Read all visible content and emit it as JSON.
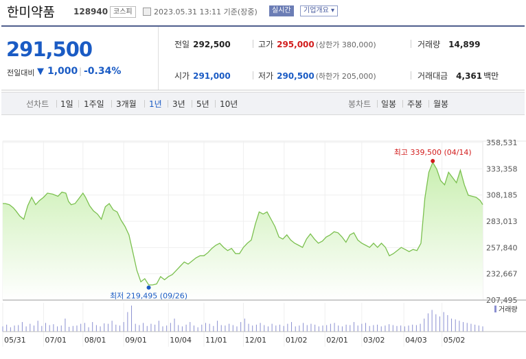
{
  "header": {
    "name": "한미약품",
    "code": "128940",
    "market": "코스피",
    "timestamp": "2023.05.31 13:11 기준(장중)",
    "live_button": "실시간",
    "company_button": "기업개요 ▾"
  },
  "quote": {
    "price": "291,500",
    "change_label": "전일대비",
    "change_arrow": "▼",
    "change_value": "1,000",
    "change_pct": "-0.34%",
    "prev_close_label": "전일",
    "prev_close": "292,500",
    "high_label": "고가",
    "high": "295,000",
    "upper_limit": "(상한가 380,000)",
    "volume_label": "거래량",
    "volume": "14,899",
    "open_label": "시가",
    "open": "291,000",
    "low_label": "저가",
    "low": "290,500",
    "lower_limit": "(하한가 205,000)",
    "turnover_label": "거래대금",
    "turnover": "4,361",
    "turnover_unit": "백만"
  },
  "tabs": {
    "line_label": "선차트",
    "periods": [
      "1일",
      "1주일",
      "3개월",
      "1년",
      "3년",
      "5년",
      "10년"
    ],
    "selected": "1년",
    "candle_label": "봉차트",
    "candle_periods": [
      "일봉",
      "주봉",
      "월봉"
    ]
  },
  "colors": {
    "price_down": "#1a5bc4",
    "price_up": "#d21c1c",
    "line": "#7bc04f",
    "area_top": "#c9efb0",
    "volume": "#8a8fd1"
  },
  "chart_data": {
    "type": "area",
    "y_ticks": [
      "358,531",
      "333,358",
      "308,185",
      "283,013",
      "257,840",
      "232,667",
      "207,495"
    ],
    "ylim": [
      207495,
      358531
    ],
    "x_ticks": [
      "05/31",
      "07/01",
      "08/01",
      "09/01",
      "10/04",
      "11/01",
      "12/01",
      "01/02",
      "02/01",
      "03/02",
      "04/03",
      "05/02"
    ],
    "x": [
      0,
      2,
      5,
      8,
      10,
      13,
      16,
      19,
      22,
      25,
      28,
      31,
      34,
      38,
      42,
      45,
      48,
      50,
      52,
      55,
      58,
      61,
      63,
      66,
      69,
      72,
      75,
      78,
      81,
      84,
      87,
      90,
      93,
      96,
      99,
      102,
      105,
      108,
      111,
      114,
      117,
      120,
      123,
      126,
      129,
      132,
      135,
      138,
      141,
      144,
      147,
      150,
      153,
      156,
      159,
      162,
      165,
      168,
      171,
      174,
      177,
      180,
      183,
      186,
      189,
      192,
      195,
      198,
      201,
      204,
      207,
      210,
      213,
      216,
      219,
      222,
      225,
      228,
      231,
      234,
      237,
      240,
      243,
      246,
      249,
      252,
      255,
      258,
      261,
      264,
      267,
      270,
      273,
      276,
      279,
      282,
      285,
      288,
      291,
      294,
      297,
      300,
      303,
      306,
      309,
      312,
      315,
      318,
      321,
      324,
      327,
      330,
      333,
      336,
      339,
      342,
      345,
      348,
      351,
      354,
      357,
      360,
      363,
      365
    ],
    "y": [
      300000,
      300000,
      299000,
      296000,
      293000,
      288000,
      285000,
      298000,
      306000,
      299000,
      303000,
      306000,
      310000,
      309000,
      307000,
      311000,
      310000,
      302000,
      299000,
      300000,
      305000,
      310000,
      306000,
      298000,
      293000,
      290000,
      285000,
      297000,
      300000,
      294000,
      292000,
      284000,
      278000,
      270000,
      253000,
      236000,
      225000,
      228000,
      222000,
      222000,
      223000,
      230000,
      227000,
      230000,
      232000,
      236000,
      240000,
      244000,
      242000,
      245000,
      248000,
      250000,
      250000,
      253000,
      257000,
      260000,
      262000,
      258000,
      255000,
      257000,
      252000,
      252000,
      258000,
      262000,
      265000,
      280000,
      292000,
      290000,
      292000,
      285000,
      278000,
      268000,
      266000,
      270000,
      265000,
      262000,
      260000,
      258000,
      266000,
      271000,
      266000,
      262000,
      264000,
      268000,
      270000,
      273000,
      272000,
      268000,
      263000,
      270000,
      272000,
      265000,
      262000,
      260000,
      258000,
      262000,
      258000,
      262000,
      258000,
      250000,
      252000,
      255000,
      258000,
      256000,
      254000,
      256000,
      255000,
      262000,
      305000,
      330000,
      339500,
      333000,
      322000,
      318000,
      330000,
      325000,
      320000,
      332000,
      318000,
      308000,
      307000,
      306000,
      303000,
      299000,
      297000
    ],
    "max_label": "최고 339,500 (04/14)",
    "min_label": "최저 219,495 (09/26)",
    "volume_label": "거래량",
    "volume": [
      12,
      16,
      10,
      14,
      15,
      22,
      12,
      18,
      14,
      25,
      13,
      20,
      15,
      17,
      12,
      14,
      30,
      11,
      13,
      14,
      18,
      20,
      10,
      22,
      15,
      12,
      19,
      18,
      25,
      16,
      14,
      22,
      45,
      60,
      18,
      15,
      20,
      13,
      18,
      16,
      25,
      12,
      14,
      20,
      30,
      15,
      12,
      16,
      22,
      14,
      10,
      16,
      20,
      18,
      13,
      25,
      15,
      14,
      18,
      15,
      12,
      22,
      30,
      18,
      14,
      16,
      20,
      15,
      12,
      18,
      14,
      16,
      13,
      18,
      22,
      12,
      14,
      20,
      15,
      18,
      16,
      12,
      14,
      15,
      18,
      20,
      14,
      12,
      16,
      15,
      22,
      14,
      18,
      20,
      13,
      15,
      16,
      12,
      14,
      17,
      15,
      13,
      14,
      12,
      14,
      16,
      15,
      18,
      30,
      42,
      50,
      40,
      35,
      45,
      38,
      30,
      28,
      25,
      22,
      20,
      18,
      16,
      14,
      12
    ]
  }
}
